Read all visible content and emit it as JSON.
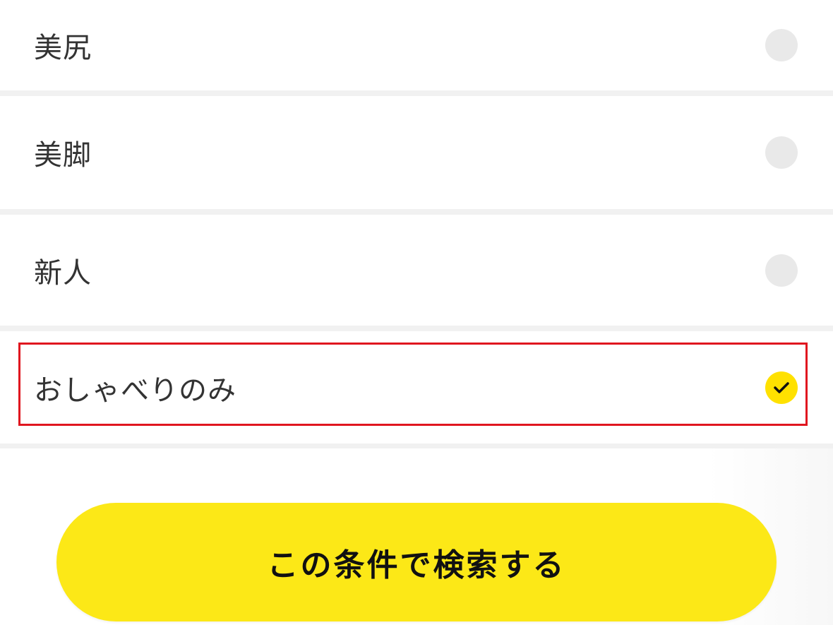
{
  "options": [
    {
      "label": "美尻",
      "checked": false
    },
    {
      "label": "美脚",
      "checked": false
    },
    {
      "label": "新人",
      "checked": false
    },
    {
      "label": "おしゃべりのみ",
      "checked": true
    }
  ],
  "search_button": {
    "label": "この条件で検索する"
  },
  "colors": {
    "accent": "#fce817",
    "checked_radio": "#ffe100",
    "unchecked_radio": "#e9e9e9",
    "highlight_border": "#e0161f",
    "divider": "#f1f1f1"
  }
}
